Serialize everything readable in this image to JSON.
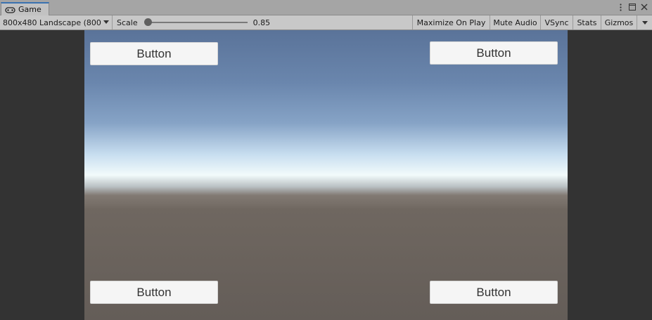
{
  "window": {
    "tab_label": "Game",
    "tab_icon": "gamepad-icon",
    "controls": [
      "more-icon",
      "maximize-icon",
      "close-icon"
    ]
  },
  "toolbar": {
    "resolution": "800x480 Landscape (800",
    "scale_label": "Scale",
    "scale_value": "0.85",
    "scale_fraction": 0.0,
    "maximize_on_play": "Maximize On Play",
    "mute_audio": "Mute Audio",
    "vsync": "VSync",
    "stats": "Stats",
    "gizmos": "Gizmos"
  },
  "game": {
    "buttons": {
      "top_left": "Button",
      "top_right": "Button",
      "bottom_left": "Button",
      "bottom_right": "Button"
    },
    "sky_color": "#6a86ad",
    "ground_color": "#645d58",
    "letterbox_color": "#333333"
  }
}
